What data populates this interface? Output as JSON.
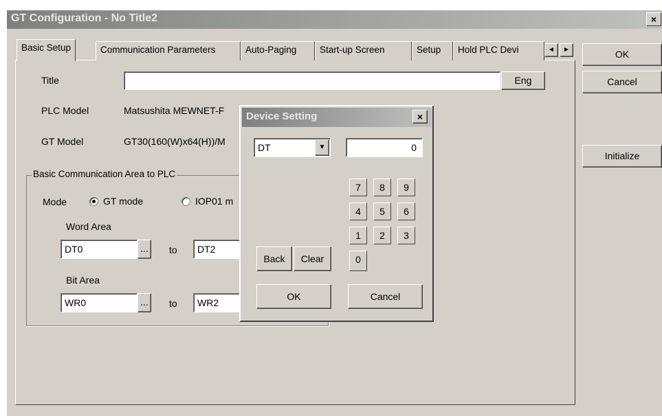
{
  "window": {
    "title": "GT Configuration - No Title2",
    "close_glyph": "×"
  },
  "tabs": [
    "Basic Setup",
    "Communication Parameters",
    "Auto-Paging",
    "Start-up Screen",
    "Setup",
    "Hold PLC Devi"
  ],
  "tab_scroll": {
    "left": "◄",
    "right": "►"
  },
  "side_buttons": {
    "ok": "OK",
    "cancel": "Cancel",
    "initialize": "Initialize"
  },
  "basic_setup": {
    "title_label": "Title",
    "title_value": "",
    "eng_button": "Eng",
    "plc_model_label": "PLC Model",
    "plc_model_value": "Matsushita MEWNET-F",
    "gt_model_label": "GT Model",
    "gt_model_value": "GT30(160(W)x64(H))/M",
    "comm_area": {
      "group_label": "Basic Communication Area to PLC",
      "mode_label": "Mode",
      "mode_gt": "GT mode",
      "mode_iop": "IOP01 m",
      "word_area_label": "Word Area",
      "word_from": "DT0",
      "word_to": "DT2",
      "bit_area_label": "Bit Area",
      "bit_from": "WR0",
      "bit_to": "WR2",
      "to_label": "to",
      "browse_glyph": "..."
    }
  },
  "device_dialog": {
    "title": "Device Setting",
    "close_glyph": "×",
    "device_type": "DT",
    "value": "0",
    "keys": [
      "7",
      "8",
      "9",
      "4",
      "5",
      "6",
      "1",
      "2",
      "3",
      "0"
    ],
    "back": "Back",
    "clear": "Clear",
    "ok": "OK",
    "cancel": "Cancel"
  }
}
